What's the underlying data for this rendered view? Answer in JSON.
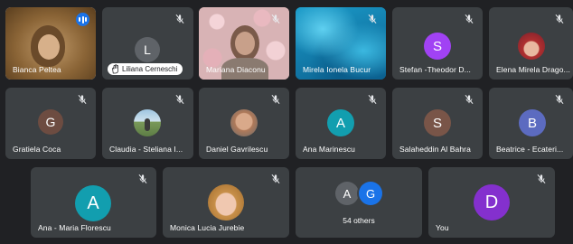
{
  "participants_row1": [
    {
      "name": "Bianca Peltea",
      "speaking": true
    },
    {
      "name": "Liliana Cerneschi",
      "initial": "L",
      "color": "#5f6368",
      "hand_raised": true
    },
    {
      "name": "Mariana Diaconu"
    },
    {
      "name": "Mirela Ionela Bucur"
    },
    {
      "name": "Stefan -Theodor D...",
      "initial": "S",
      "color": "#a142f4"
    },
    {
      "name": "Elena Mirela Drago..."
    }
  ],
  "participants_row2": [
    {
      "name": "Gratiela Coca",
      "initial": "G",
      "color": "#6d4c41"
    },
    {
      "name": "Claudia - Steliana I..."
    },
    {
      "name": "Daniel Gavrilescu"
    },
    {
      "name": "Ana Marinescu",
      "initial": "A",
      "color": "#129eaf"
    },
    {
      "name": "Salaheddin Al Bahra",
      "initial": "S",
      "color": "#795548"
    },
    {
      "name": "Beatrice - Ecateri...",
      "initial": "B",
      "color": "#5c6bc0"
    }
  ],
  "participants_row3": [
    {
      "name": "Ana - Maria Florescu",
      "initial": "A",
      "color": "#129eaf"
    },
    {
      "name": "Monica Lucia Jurebie"
    },
    {
      "others_label": "54 others",
      "initial_a": "A",
      "initial_g": "G",
      "color_a": "#5f6368",
      "color_g": "#1a73e8"
    },
    {
      "name": "You",
      "initial": "D",
      "color": "#8430ce"
    }
  ]
}
